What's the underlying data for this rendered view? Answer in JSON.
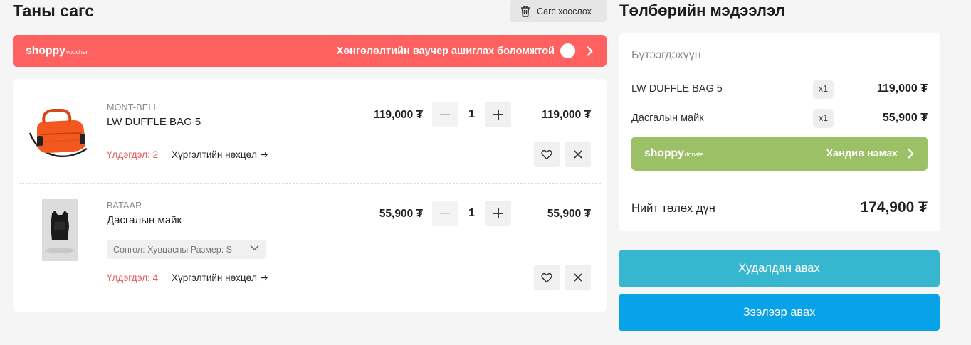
{
  "header": {
    "title": "Таны сагс",
    "clear_label": "Сагс хоослох",
    "icon": "trash-icon"
  },
  "voucher": {
    "brand": "shoppy",
    "brand_sub": "voucher",
    "text": "Хөнгөлөлтийн ваучер ашиглах боломжтой",
    "toggle_on": false,
    "color": "#ff6161"
  },
  "cart": {
    "items": [
      {
        "brand": "MONT-BELL",
        "name": "LW DUFFLE BAG 5",
        "unit_price": "119,000 ₮",
        "qty": "1",
        "line_total": "119,000 ₮",
        "stock": "Үлдэгдэл: 2",
        "ship": "Хүргэлтийн нөхцөл",
        "variant": null
      },
      {
        "brand": "BATAAR",
        "name": "Дасгалын майк",
        "unit_price": "55,900 ₮",
        "qty": "1",
        "line_total": "55,900 ₮",
        "stock": "Үлдэгдэл: 4",
        "ship": "Хүргэлтийн нөхцөл",
        "variant": "Сонгол: Хувцасны Размер: S"
      }
    ]
  },
  "summary": {
    "title": "Төлбөрийн мэдээлэл",
    "subtitle": "Бүтээгдэхүүн",
    "rows": [
      {
        "name": "LW DUFFLE BAG 5",
        "qty": "x1",
        "amount": "119,000 ₮"
      },
      {
        "name": "Дасгалын майк",
        "qty": "x1",
        "amount": "55,900 ₮"
      }
    ],
    "donate": {
      "brand": "shoppy",
      "brand_sub": "donate",
      "text": "Хандив нэмэх",
      "color": "#9cc065"
    },
    "total_label": "Нийт төлөх дүн",
    "total_value": "174,900 ₮"
  },
  "actions": {
    "buy_now": "Худалдан авах",
    "buy_credit": "Зээлээр авах",
    "buy_now_color": "#37b7cf",
    "buy_credit_color": "#08a2e8"
  }
}
